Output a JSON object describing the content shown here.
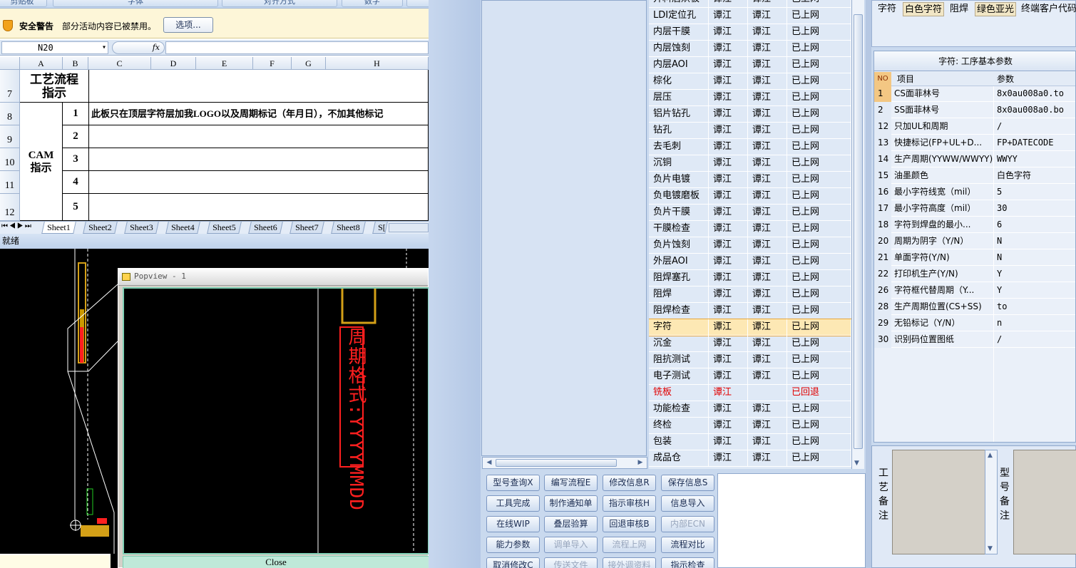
{
  "excel": {
    "ribbon_groups": [
      "剪贴板",
      "字体",
      "对齐方式",
      "数字"
    ],
    "security": {
      "title": "安全警告",
      "message": "部分活动内容已被禁用。",
      "options_button": "选项..."
    },
    "name_box": "N20",
    "fx_label": "fx",
    "formula_value": "",
    "columns": [
      "A",
      "B",
      "C",
      "D",
      "E",
      "F",
      "G",
      "H"
    ],
    "rows": [
      "7",
      "8",
      "9",
      "10",
      "11",
      "12"
    ],
    "cells": {
      "process_guide": "工艺流程指示",
      "cam_guide": "CAM指示",
      "numbers": [
        "1",
        "2",
        "3",
        "4",
        "5"
      ],
      "note_1": "此板只在顶层字符层加我LOGO以及周期标记（年月日），不加其他标记"
    },
    "sheet_tabs": [
      "Sheet1",
      "Sheet2",
      "Sheet3",
      "Sheet4",
      "Sheet5",
      "Sheet6",
      "Sheet7",
      "Sheet8",
      "S["
    ],
    "active_sheet": "Sheet1",
    "status": "就绪"
  },
  "popview": {
    "title": "Popview - 1",
    "date_label": "周期格式:YYYYMMDD",
    "footer": "Close"
  },
  "process": {
    "rows": [
      {
        "name": "开料后烘板",
        "a": "谭江",
        "b": "谭江",
        "status": "已上网"
      },
      {
        "name": "LDI定位孔",
        "a": "谭江",
        "b": "谭江",
        "status": "已上网"
      },
      {
        "name": "内层干膜",
        "a": "谭江",
        "b": "谭江",
        "status": "已上网"
      },
      {
        "name": "内层蚀刻",
        "a": "谭江",
        "b": "谭江",
        "status": "已上网"
      },
      {
        "name": "内层AOI",
        "a": "谭江",
        "b": "谭江",
        "status": "已上网"
      },
      {
        "name": "棕化",
        "a": "谭江",
        "b": "谭江",
        "status": "已上网"
      },
      {
        "name": "层压",
        "a": "谭江",
        "b": "谭江",
        "status": "已上网"
      },
      {
        "name": "铝片钻孔",
        "a": "谭江",
        "b": "谭江",
        "status": "已上网"
      },
      {
        "name": "钻孔",
        "a": "谭江",
        "b": "谭江",
        "status": "已上网"
      },
      {
        "name": "去毛刺",
        "a": "谭江",
        "b": "谭江",
        "status": "已上网"
      },
      {
        "name": "沉铜",
        "a": "谭江",
        "b": "谭江",
        "status": "已上网"
      },
      {
        "name": "负片电镀",
        "a": "谭江",
        "b": "谭江",
        "status": "已上网"
      },
      {
        "name": "负电镀磨板",
        "a": "谭江",
        "b": "谭江",
        "status": "已上网"
      },
      {
        "name": "负片干膜",
        "a": "谭江",
        "b": "谭江",
        "status": "已上网"
      },
      {
        "name": "干膜检查",
        "a": "谭江",
        "b": "谭江",
        "status": "已上网"
      },
      {
        "name": "负片蚀刻",
        "a": "谭江",
        "b": "谭江",
        "status": "已上网"
      },
      {
        "name": "外层AOI",
        "a": "谭江",
        "b": "谭江",
        "status": "已上网"
      },
      {
        "name": "阻焊塞孔",
        "a": "谭江",
        "b": "谭江",
        "status": "已上网"
      },
      {
        "name": "阻焊",
        "a": "谭江",
        "b": "谭江",
        "status": "已上网"
      },
      {
        "name": "阻焊检查",
        "a": "谭江",
        "b": "谭江",
        "status": "已上网"
      },
      {
        "name": "字符",
        "a": "谭江",
        "b": "谭江",
        "status": "已上网"
      },
      {
        "name": "沉金",
        "a": "谭江",
        "b": "谭江",
        "status": "已上网"
      },
      {
        "name": "阻抗测试",
        "a": "谭江",
        "b": "谭江",
        "status": "已上网"
      },
      {
        "name": "电子测试",
        "a": "谭江",
        "b": "谭江",
        "status": "已上网"
      },
      {
        "name": "铣板",
        "a": "谭江",
        "b": "",
        "status": "已回退"
      },
      {
        "name": "功能检查",
        "a": "谭江",
        "b": "谭江",
        "status": "已上网"
      },
      {
        "name": "终检",
        "a": "谭江",
        "b": "谭江",
        "status": "已上网"
      },
      {
        "name": "包装",
        "a": "谭江",
        "b": "谭江",
        "status": "已上网"
      },
      {
        "name": "成品仓",
        "a": "谭江",
        "b": "谭江",
        "status": "已上网"
      }
    ],
    "selected": "字符",
    "returned": "铣板",
    "selected_color": "#fde8b4",
    "returned_color": "#e00000"
  },
  "buttons": [
    [
      "型号查询X",
      "编写流程E",
      "修改信息R",
      "保存信息S"
    ],
    [
      "工具完成",
      "制作通知单",
      "指示审核H",
      "信息导入"
    ],
    [
      "在线WIP",
      "叠层验算",
      "回退审核B",
      "内部ECN"
    ],
    [
      "能力参数",
      "调单导入",
      "流程上网",
      "流程对比"
    ],
    [
      "取消修改C",
      "传送文件",
      "接外调资料",
      "指示检查"
    ]
  ],
  "disabled_buttons": [
    "内部ECN",
    "调单导入",
    "流程上网",
    "传送文件",
    "接外调资料"
  ],
  "toolbar": [
    "字符",
    "白色字符",
    "阻焊",
    "绿色亚光",
    "终端客户代码"
  ],
  "params": {
    "caption": "字符: 工序基本参数",
    "headers": {
      "no": "NO",
      "item": "项目",
      "value": "参数"
    },
    "rows": [
      {
        "no": "1",
        "item": "CS面菲林号",
        "value": "8x0au008a0.to"
      },
      {
        "no": "2",
        "item": "SS面菲林号",
        "value": "8x0au008a0.bo"
      },
      {
        "no": "12",
        "item": "只加UL和周期",
        "value": "/"
      },
      {
        "no": "13",
        "item": "快捷标记(FP+UL+D...",
        "value": "FP+DATECODE"
      },
      {
        "no": "14",
        "item": "生产周期(YYWW/WWYY)",
        "value": "WWYY"
      },
      {
        "no": "15",
        "item": "油墨颜色",
        "value": "白色字符"
      },
      {
        "no": "16",
        "item": "最小字符线宽（mil）",
        "value": "5"
      },
      {
        "no": "17",
        "item": "最小字符高度（mil）",
        "value": "30"
      },
      {
        "no": "18",
        "item": "字符到焊盘的最小...",
        "value": "6"
      },
      {
        "no": "20",
        "item": "周期为阴字（Y/N）",
        "value": "N"
      },
      {
        "no": "21",
        "item": "单面字符(Y/N)",
        "value": "N"
      },
      {
        "no": "22",
        "item": "打印机生产(Y/N)",
        "value": "Y"
      },
      {
        "no": "26",
        "item": "字符框代替周期（Y...",
        "value": "Y"
      },
      {
        "no": "28",
        "item": "生产周期位置(CS+SS)",
        "value": "to"
      },
      {
        "no": "29",
        "item": "无铅标记（Y/N）",
        "value": "n"
      },
      {
        "no": "30",
        "item": "识别码位置图纸",
        "value": "/"
      }
    ]
  },
  "notes": {
    "process_note_label": "工艺备注",
    "model_note_label": "型号备注"
  }
}
